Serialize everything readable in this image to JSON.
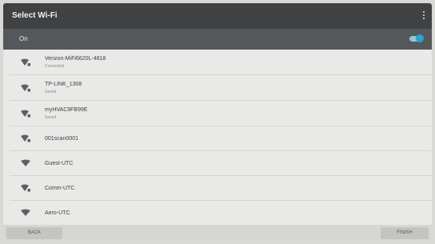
{
  "header": {
    "title": "Select Wi-Fi",
    "menu_icon": "overflow-menu-icon"
  },
  "wifi_toggle": {
    "label": "On",
    "enabled": true,
    "accent": "#2aa3cf"
  },
  "networks": [
    {
      "ssid": "Verizon-MiFi6620L-4818",
      "status": "Connected",
      "icon": "wifi-lock-icon"
    },
    {
      "ssid": "TP-LINK_1308",
      "status": "Saved",
      "icon": "wifi-lock-icon"
    },
    {
      "ssid": "myHVAC9FB99E",
      "status": "Saved",
      "icon": "wifi-lock-icon"
    },
    {
      "ssid": "001scan0001",
      "status": "",
      "icon": "wifi-lock-icon"
    },
    {
      "ssid": "Guest-UTC",
      "status": "",
      "icon": "wifi-icon"
    },
    {
      "ssid": "Comm-UTC",
      "status": "",
      "icon": "wifi-lock-icon"
    },
    {
      "ssid": "Aero-UTC",
      "status": "",
      "icon": "wifi-icon"
    }
  ],
  "footer": {
    "back_label": "BACK",
    "finish_label": "FINISH"
  }
}
